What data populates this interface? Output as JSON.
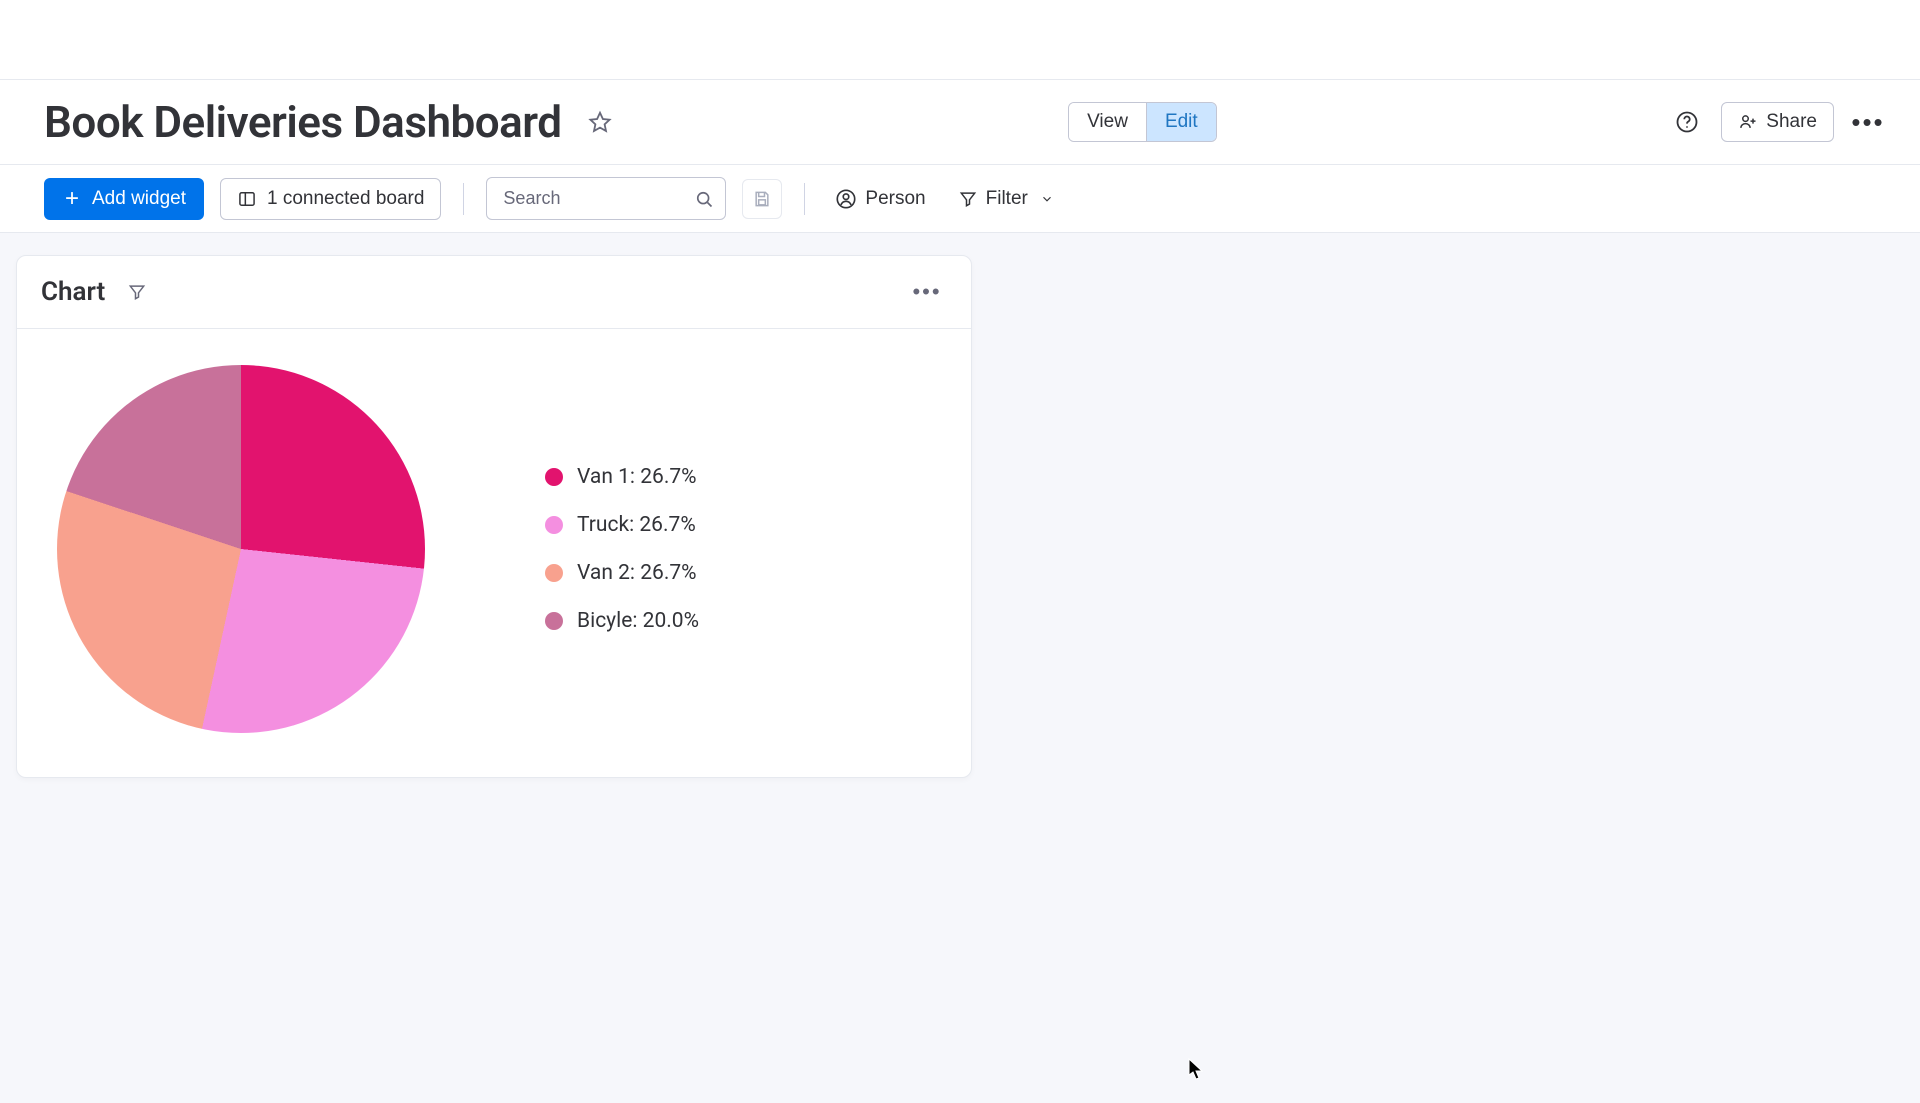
{
  "header": {
    "title": "Book Deliveries Dashboard",
    "mode_view": "View",
    "mode_edit": "Edit",
    "share_label": "Share"
  },
  "toolbar": {
    "add_widget_label": "Add widget",
    "connected_boards_label": "1 connected board",
    "search_placeholder": "Search",
    "person_label": "Person",
    "filter_label": "Filter"
  },
  "widget": {
    "title": "Chart"
  },
  "chart_data": {
    "type": "pie",
    "title": "",
    "series": [
      {
        "name": "Van 1",
        "percent": 26.7,
        "color": "#e2136e"
      },
      {
        "name": "Truck",
        "percent": 26.7,
        "color": "#f48fe0"
      },
      {
        "name": "Van 2",
        "percent": 26.7,
        "color": "#f8a18e"
      },
      {
        "name": "Bicyle",
        "percent": 20.0,
        "color": "#c8719a"
      }
    ],
    "legend_position": "right"
  },
  "legend_text": {
    "0": "Van 1: 26.7%",
    "1": "Truck: 26.7%",
    "2": "Van 2: 26.7%",
    "3": "Bicyle: 20.0%"
  }
}
